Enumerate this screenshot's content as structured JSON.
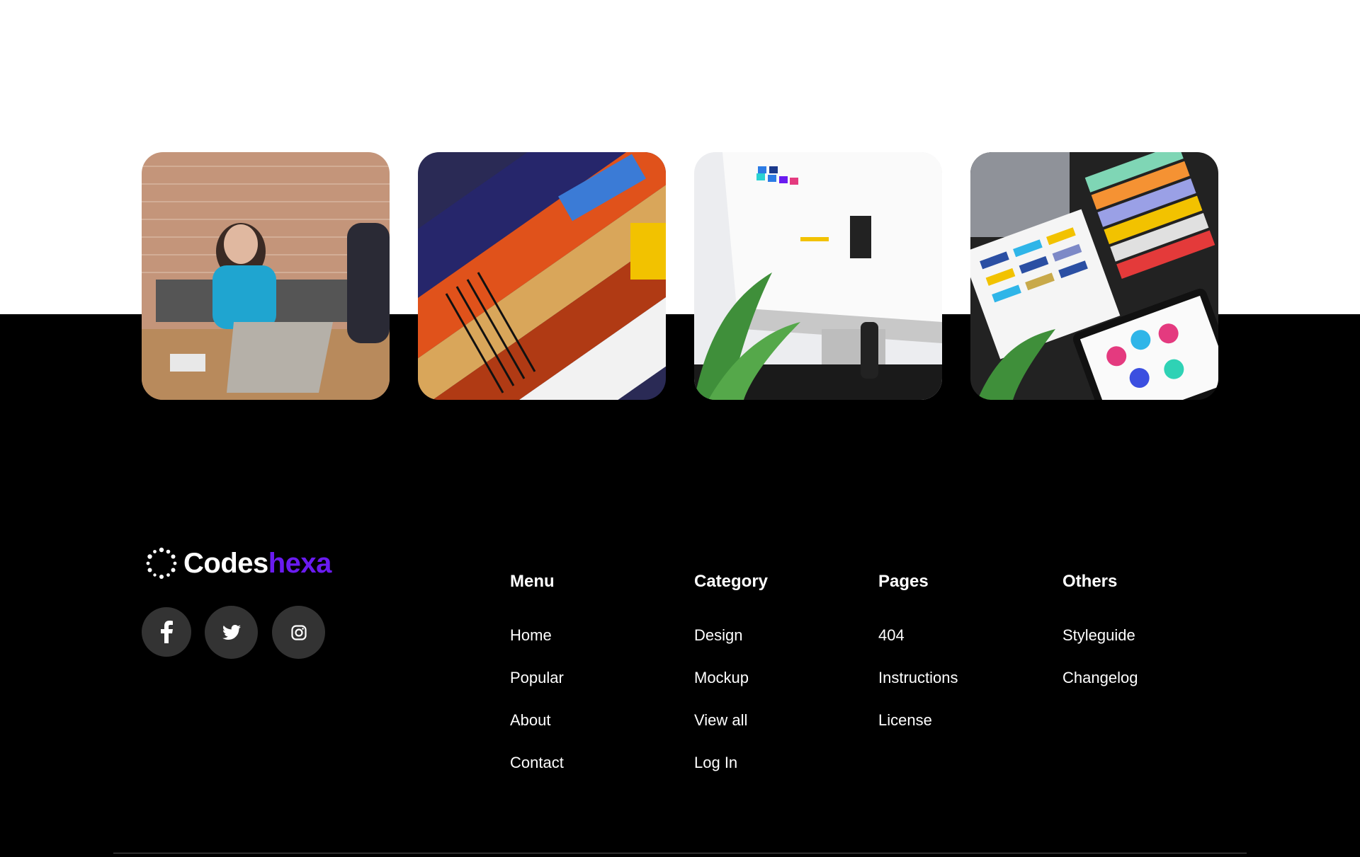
{
  "brand": {
    "name_part1": "Codes",
    "name_part2": "hexa"
  },
  "gallery": [
    {
      "alt": "office meeting photo"
    },
    {
      "alt": "abstract art prints photo"
    },
    {
      "alt": "ui kit on monitor photo"
    },
    {
      "alt": "design swatches photo"
    }
  ],
  "socials": [
    {
      "icon": "facebook-icon"
    },
    {
      "icon": "twitter-icon"
    },
    {
      "icon": "instagram-icon"
    }
  ],
  "footer": {
    "menu": {
      "title": "Menu",
      "links": [
        "Home",
        "Popular",
        "About",
        "Contact"
      ]
    },
    "category": {
      "title": "Category",
      "links": [
        "Design",
        "Mockup",
        "View all",
        "Log In"
      ]
    },
    "pages": {
      "title": "Pages",
      "links": [
        "404",
        "Instructions",
        "License"
      ]
    },
    "others": {
      "title": "Others",
      "links": [
        "Styleguide",
        "Changelog"
      ]
    }
  },
  "colors": {
    "accent": "#6a1bf0",
    "social_bg": "#333333",
    "background": "#000000"
  }
}
